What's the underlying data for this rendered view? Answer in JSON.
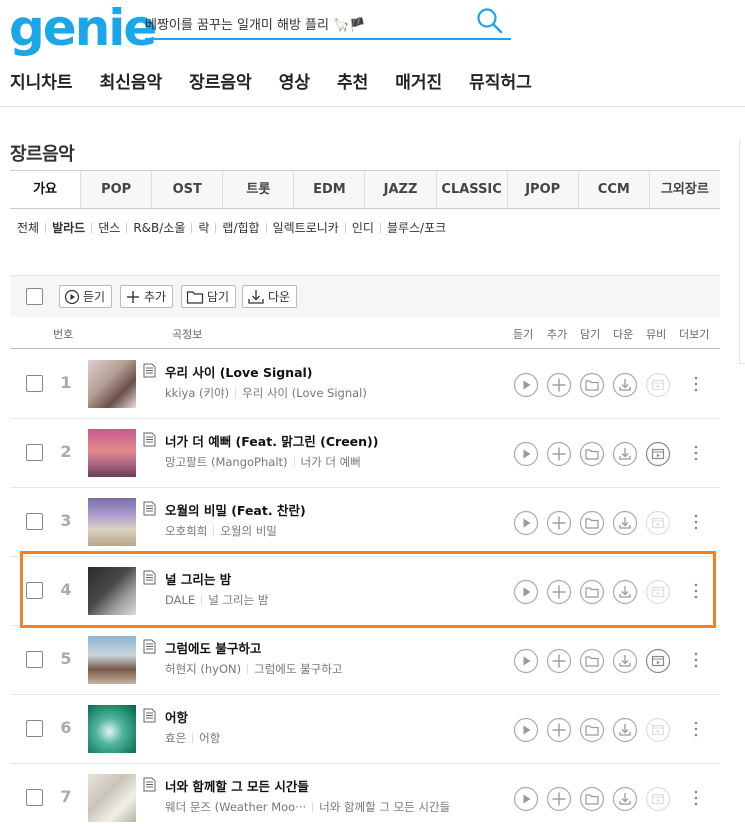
{
  "header": {
    "logo": "genie",
    "search_value": "베짱이를 꿈꾸는 일개미 해방 플리 🦙🏴"
  },
  "gnb": [
    "지니차트",
    "최신음악",
    "장르음악",
    "영상",
    "추천",
    "매거진",
    "뮤직허그"
  ],
  "section_title": "장르음악",
  "tabs": [
    "가요",
    "POP",
    "OST",
    "트롯",
    "EDM",
    "JAZZ",
    "CLASSIC",
    "JPOP",
    "CCM",
    "그외장르"
  ],
  "active_tab": "가요",
  "subgenres": [
    "전체",
    "발라드",
    "댄스",
    "R&B/소울",
    "락",
    "랩/힙합",
    "일렉트로니카",
    "인디",
    "블루스/포크"
  ],
  "active_subgenre": "발라드",
  "toolbar": {
    "listen": "듣기",
    "add": "추가",
    "save": "담기",
    "download": "다운"
  },
  "list_header": {
    "number": "번호",
    "info": "곡정보",
    "listen": "듣기",
    "add": "추가",
    "save": "담기",
    "download": "다운",
    "mv": "뮤비",
    "more": "더보기"
  },
  "songs": [
    {
      "rank": "1",
      "title": "우리 사이 (Love Signal)",
      "artist": "kkiya (키야)",
      "album": "우리 사이 (Love Signal)",
      "mv": false
    },
    {
      "rank": "2",
      "title": "너가 더 예뻐 (Feat. 맑그린 (Creen))",
      "artist": "망고팔트 (MangoPhalt)",
      "album": "너가 더 예뻐",
      "mv": true
    },
    {
      "rank": "3",
      "title": "오월의 비밀 (Feat. 찬란)",
      "artist": "오호희희",
      "album": "오월의 비밀",
      "mv": false
    },
    {
      "rank": "4",
      "title": "널 그리는 밤",
      "artist": "DALE",
      "album": "널 그리는 밤",
      "mv": false
    },
    {
      "rank": "5",
      "title": "그럼에도 불구하고",
      "artist": "허현지 (hyON)",
      "album": "그럼에도 불구하고",
      "mv": true
    },
    {
      "rank": "6",
      "title": "어항",
      "artist": "효은",
      "album": "어항",
      "mv": false
    },
    {
      "rank": "7",
      "title": "너와 함께할 그 모든 시간들",
      "artist": "웨더 문즈 (Weather Moo···",
      "album": "너와 함께할 그 모든 시간들",
      "mv": false
    }
  ],
  "colors": {
    "brand": "#1aa6e8",
    "highlight": "#f0822a"
  }
}
